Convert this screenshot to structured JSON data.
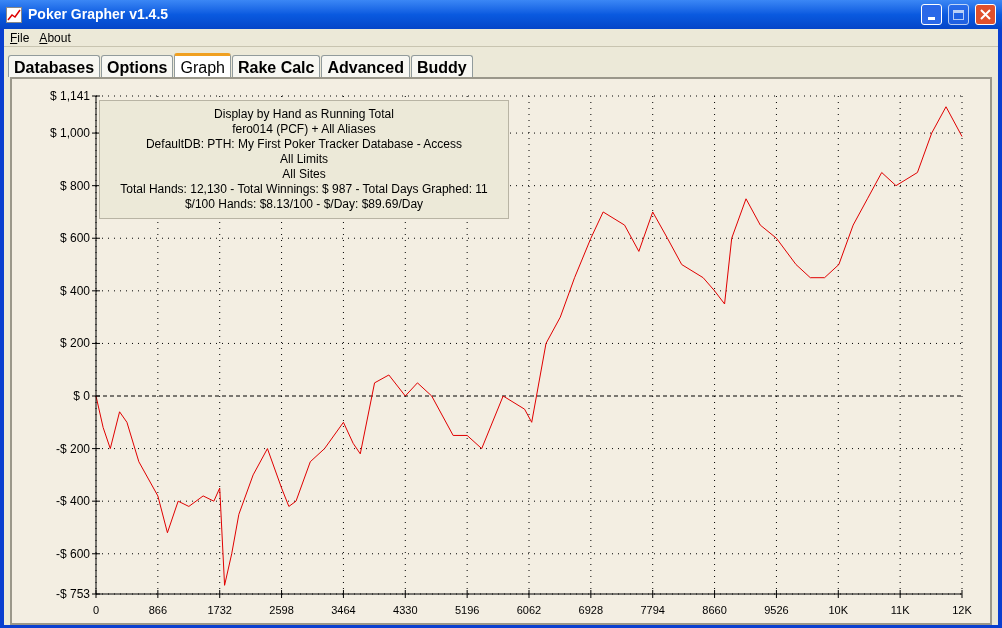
{
  "window": {
    "title": "Poker Grapher v1.4.5"
  },
  "menu": [
    {
      "label": "File"
    },
    {
      "label": "About"
    }
  ],
  "tabs": [
    {
      "label": "Databases",
      "selected": false
    },
    {
      "label": "Options",
      "selected": false
    },
    {
      "label": "Graph",
      "selected": true
    },
    {
      "label": "Rake Calc",
      "selected": false
    },
    {
      "label": "Advanced",
      "selected": false
    },
    {
      "label": "Buddy",
      "selected": false
    }
  ],
  "graph": {
    "info_lines": [
      "Display by Hand as Running Total",
      "fero014 (PCF) + All Aliases",
      "DefaultDB: PTH: My First Poker Tracker Database - Access",
      "All Limits",
      "All Sites",
      "Total Hands: 12,130 - Total Winnings: $ 987 - Total Days Graphed: 11",
      "$/100 Hands: $8.13/100 - $/Day: $89.69/Day"
    ],
    "chart_data": {
      "type": "line",
      "grid": true,
      "xlim": [
        0,
        12124
      ],
      "ylim": [
        -753,
        1141
      ],
      "xticks": [
        0,
        866,
        1732,
        2598,
        3464,
        4330,
        5196,
        6062,
        6928,
        7794,
        8660,
        9526,
        {
          "value": 10392,
          "label": "10K"
        },
        {
          "value": 11258,
          "label": "11K"
        },
        {
          "value": 12124,
          "label": "12K"
        }
      ],
      "yticks": [
        {
          "value": 1141,
          "label": "$ 1,141"
        },
        {
          "value": 1000,
          "label": "$ 1,000"
        },
        {
          "value": 800,
          "label": "$ 800"
        },
        {
          "value": 600,
          "label": "$ 600"
        },
        {
          "value": 400,
          "label": "$ 400"
        },
        {
          "value": 200,
          "label": "$ 200"
        },
        {
          "value": 0,
          "label": "$ 0"
        },
        {
          "value": -200,
          "label": "-$ 200"
        },
        {
          "value": -400,
          "label": "-$ 400"
        },
        {
          "value": -600,
          "label": "-$ 600"
        },
        {
          "value": -753,
          "label": "-$ 753"
        }
      ],
      "x": [
        0,
        100,
        200,
        330,
        433,
        600,
        866,
        1000,
        1150,
        1300,
        1500,
        1650,
        1732,
        1800,
        1900,
        2000,
        2200,
        2400,
        2598,
        2700,
        2800,
        3000,
        3200,
        3464,
        3600,
        3700,
        3900,
        4100,
        4330,
        4500,
        4700,
        5000,
        5196,
        5400,
        5700,
        6000,
        6100,
        6300,
        6500,
        6700,
        6928,
        7100,
        7400,
        7600,
        7794,
        8000,
        8200,
        8500,
        8660,
        8800,
        8900,
        9100,
        9300,
        9526,
        9800,
        10000,
        10200,
        10400,
        10600,
        10800,
        11000,
        11200,
        11500,
        11700,
        11900,
        12124
      ],
      "series": [
        {
          "color": "#e00000",
          "values": [
            0,
            -120,
            -200,
            -60,
            -100,
            -250,
            -380,
            -520,
            -400,
            -420,
            -380,
            -400,
            -350,
            -720,
            -600,
            -450,
            -300,
            -200,
            -350,
            -420,
            -400,
            -250,
            -200,
            -100,
            -180,
            -220,
            50,
            80,
            0,
            50,
            0,
            -150,
            -150,
            -200,
            0,
            -50,
            -100,
            200,
            300,
            450,
            600,
            700,
            650,
            550,
            700,
            600,
            500,
            450,
            400,
            350,
            600,
            750,
            650,
            600,
            500,
            450,
            450,
            500,
            650,
            750,
            850,
            800,
            850,
            1000,
            1100,
            987
          ]
        }
      ]
    }
  }
}
